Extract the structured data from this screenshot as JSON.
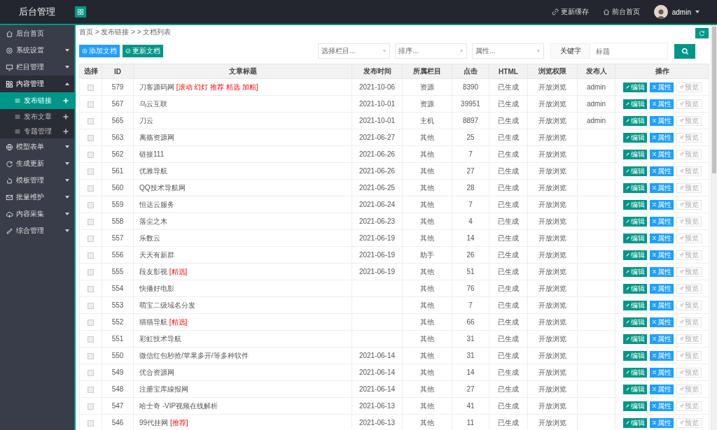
{
  "header": {
    "title": "后台管理",
    "links": [
      {
        "label": "更新缓存",
        "kind": "cache"
      },
      {
        "label": "前台首页",
        "kind": "home"
      }
    ],
    "user": "admin"
  },
  "sidebar": {
    "items": [
      {
        "label": "后台首页",
        "selected": false
      },
      {
        "label": "系统设置",
        "selected": false,
        "expanded": false
      },
      {
        "label": "栏目管理",
        "selected": false,
        "expanded": false
      },
      {
        "label": "内容管理",
        "selected": false,
        "expanded": true,
        "children": [
          {
            "label": "发布链接",
            "selected": true
          },
          {
            "label": "发布文章",
            "selected": false
          },
          {
            "label": "专题管理",
            "selected": false
          }
        ]
      },
      {
        "label": "模型表单",
        "selected": false,
        "expanded": false
      },
      {
        "label": "生成更新",
        "selected": false,
        "expanded": false
      },
      {
        "label": "模板管理",
        "selected": false,
        "expanded": false
      },
      {
        "label": "批量维护",
        "selected": false,
        "expanded": false
      },
      {
        "label": "内容采集",
        "selected": false,
        "expanded": false
      },
      {
        "label": "综合管理",
        "selected": false,
        "expanded": false
      }
    ]
  },
  "breadcrumb": "首页 > 发布链接 > > 文档列表",
  "toolbar": {
    "buttons": [
      {
        "label": "添加文档",
        "kind": "add"
      },
      {
        "label": "更新文档",
        "kind": "update"
      }
    ],
    "filters": [
      {
        "placeholder": "选择栏目..."
      },
      {
        "placeholder": "排序..."
      },
      {
        "placeholder": "属性..."
      }
    ],
    "keyword_label": "关键字",
    "search": {
      "placeholder": "标题"
    }
  },
  "table": {
    "columns": [
      "选择",
      "ID",
      "文章标题",
      "发布时间",
      "所属栏目",
      "点击",
      "HTML",
      "浏览权限",
      "发布人",
      "操作"
    ],
    "rows": [
      {
        "checked": false,
        "id": "579",
        "title": "刀客源码网",
        "tags": "[滚动 幻灯 推荐 精选 加粗]",
        "date": "2021-10-06",
        "category": "资源",
        "clicks": "8390",
        "html": "已生成",
        "permission": "开放浏览",
        "author": "admin",
        "actions": [
          "编辑",
          "属性",
          "预览"
        ]
      },
      {
        "checked": false,
        "id": "567",
        "title": "乌云互联",
        "date": "2021-10-01",
        "category": "资源",
        "clicks": "39951",
        "html": "已生成",
        "permission": "开放浏览",
        "author": "admin",
        "actions": [
          "编辑",
          "属性",
          "预览"
        ]
      },
      {
        "checked": false,
        "id": "565",
        "title": "刀云",
        "date": "2021-10-01",
        "category": "主机",
        "clicks": "8897",
        "html": "已生成",
        "permission": "开放浏览",
        "author": "admin",
        "actions": [
          "编辑",
          "属性",
          "预览"
        ]
      },
      {
        "checked": false,
        "id": "563",
        "title": "离殇资源网",
        "date": "2021-06-27",
        "category": "其他",
        "clicks": "25",
        "html": "已生成",
        "permission": "开放浏览",
        "actions": [
          "编辑",
          "属性",
          "预览"
        ]
      },
      {
        "checked": false,
        "id": "562",
        "title": "链接111",
        "date": "2021-06-26",
        "category": "其他",
        "clicks": "7",
        "html": "已生成",
        "permission": "开放浏览",
        "actions": [
          "编辑",
          "属性",
          "预览"
        ]
      },
      {
        "checked": false,
        "id": "561",
        "title": "优雅导航",
        "date": "2021-06-26",
        "category": "其他",
        "clicks": "27",
        "html": "已生成",
        "permission": "开放浏览",
        "actions": [
          "编辑",
          "属性",
          "预览"
        ]
      },
      {
        "checked": false,
        "id": "560",
        "title": "QQ技术导航网",
        "date": "2021-06-25",
        "category": "其他",
        "clicks": "28",
        "html": "已生成",
        "permission": "开放浏览",
        "actions": [
          "编辑",
          "属性",
          "预览"
        ]
      },
      {
        "checked": false,
        "id": "559",
        "title": "恒达云服务",
        "date": "2021-06-24",
        "category": "其他",
        "clicks": "7",
        "html": "已生成",
        "permission": "开放浏览",
        "actions": [
          "编辑",
          "属性",
          "预览"
        ]
      },
      {
        "checked": false,
        "id": "558",
        "title": "落尘之木",
        "date": "2021-06-23",
        "category": "其他",
        "clicks": "4",
        "html": "已生成",
        "permission": "开放浏览",
        "actions": [
          "编辑",
          "属性",
          "预览"
        ]
      },
      {
        "checked": false,
        "id": "557",
        "title": "乐数云",
        "date": "2021-06-19",
        "category": "其他",
        "clicks": "14",
        "html": "已生成",
        "permission": "开放浏览",
        "actions": [
          "编辑",
          "属性",
          "预览"
        ]
      },
      {
        "checked": false,
        "id": "556",
        "title": "天天有新群",
        "date": "2021-06-19",
        "category": "助手",
        "clicks": "26",
        "html": "已生成",
        "permission": "开放浏览",
        "actions": [
          "编辑",
          "属性",
          "预览"
        ]
      },
      {
        "checked": false,
        "id": "555",
        "title": "段友影视",
        "tags": "[精选]",
        "date": "2021-06-19",
        "category": "其他",
        "clicks": "51",
        "html": "已生成",
        "permission": "开放浏览",
        "actions": [
          "编辑",
          "属性",
          "预览"
        ]
      },
      {
        "checked": false,
        "id": "554",
        "title": "快播好电影",
        "category": "其他",
        "clicks": "76",
        "html": "已生成",
        "permission": "开放浏览",
        "actions": [
          "编辑",
          "属性",
          "预览"
        ]
      },
      {
        "checked": false,
        "id": "553",
        "title": "萌宝二级域名分发",
        "category": "其他",
        "clicks": "7",
        "html": "已生成",
        "permission": "开放浏览",
        "actions": [
          "编辑",
          "属性",
          "预览"
        ]
      },
      {
        "checked": false,
        "id": "552",
        "title": "猫猫导航",
        "tags": "[精选]",
        "category": "其他",
        "clicks": "66",
        "html": "已生成",
        "permission": "开放浏览",
        "actions": [
          "编辑",
          "属性",
          "预览"
        ]
      },
      {
        "checked": false,
        "id": "551",
        "title": "彩虹技术导航",
        "category": "其他",
        "clicks": "31",
        "html": "已生成",
        "permission": "开放浏览",
        "actions": [
          "编辑",
          "属性",
          "预览"
        ]
      },
      {
        "checked": false,
        "id": "550",
        "title": "微信红包秒抢/苹果多开/等多种软件",
        "date": "2021-06-14",
        "category": "其他",
        "clicks": "31",
        "html": "已生成",
        "permission": "开放浏览",
        "actions": [
          "编辑",
          "属性",
          "预览"
        ]
      },
      {
        "checked": false,
        "id": "549",
        "title": "优合资源网",
        "date": "2021-06-14",
        "category": "其他",
        "clicks": "14",
        "html": "已生成",
        "permission": "开放浏览",
        "actions": [
          "编辑",
          "属性",
          "预览"
        ]
      },
      {
        "checked": false,
        "id": "548",
        "title": "注册宝库線报网",
        "date": "2021-06-14",
        "category": "其他",
        "clicks": "27",
        "html": "已生成",
        "permission": "开放浏览",
        "actions": [
          "编辑",
          "属性",
          "预览"
        ]
      },
      {
        "checked": false,
        "id": "547",
        "title": "哈士奇 -VIP视频在线解析",
        "date": "2021-06-13",
        "category": "其他",
        "clicks": "41",
        "html": "已生成",
        "permission": "开放浏览",
        "actions": [
          "编辑",
          "属性",
          "预览"
        ]
      },
      {
        "checked": false,
        "id": "546",
        "title": "99代挂网",
        "tags": "[推荐]",
        "date": "2021-06-13",
        "category": "其他",
        "clicks": "11",
        "html": "已生成",
        "permission": "开放浏览",
        "actions": [
          "编辑",
          "属性",
          "预览"
        ]
      }
    ]
  }
}
